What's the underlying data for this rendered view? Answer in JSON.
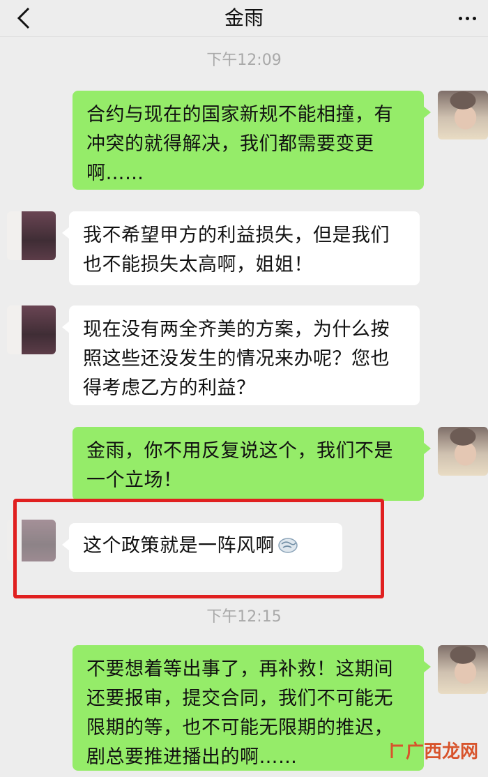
{
  "header": {
    "title": "金雨"
  },
  "timestamps": [
    "下午12:09",
    "下午12:15"
  ],
  "messages": [
    {
      "sender": "me",
      "text": "合约与现在的国家新规不能相撞，有冲突的就得解决，我们都需要变更啊……"
    },
    {
      "sender": "other",
      "text": "我不希望甲方的利益损失，但是我们也不能损失太高啊，姐姐！"
    },
    {
      "sender": "other",
      "text": "现在没有两全齐美的方案，为什么按照这些还没发生的情况来办呢？您也得考虑乙方的利益？"
    },
    {
      "sender": "me",
      "text": "金雨，你不用反复说这个，我们不是一个立场！"
    },
    {
      "sender": "other",
      "text": "这个政策就是一阵风啊",
      "emoji": "wind-emoji"
    },
    {
      "sender": "me",
      "text": "不要想着等出事了，再补救！这期间还要报审，提交合同，我们不可能无限期的等，也不可能无限期的推迟，剧总要推进播出的啊……"
    }
  ],
  "watermark": {
    "text": "广西龙网"
  },
  "colors": {
    "green_bubble": "#95ec69",
    "highlight": "#e02020",
    "background": "#ededed"
  }
}
